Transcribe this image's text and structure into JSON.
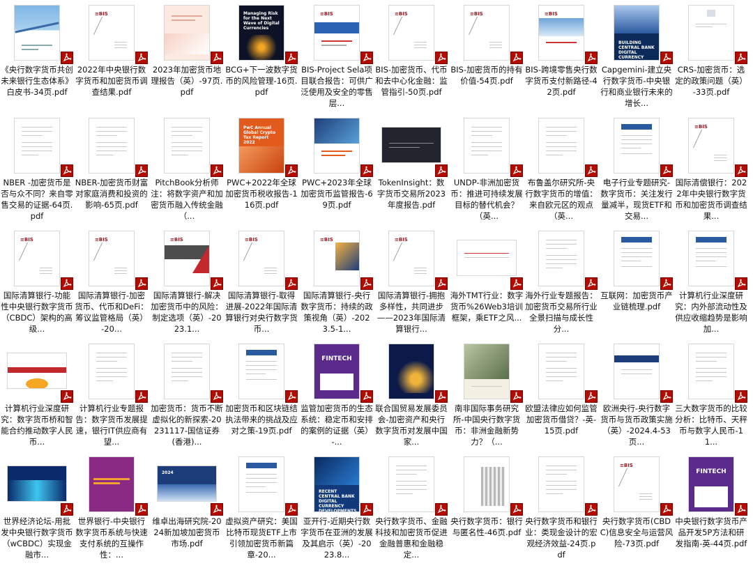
{
  "files": [
    {
      "label": "《央行数字货币共创未来银行生态体系》白皮书-34页.pdf",
      "thumb": "bridge"
    },
    {
      "label": "2022年中央银行数字货币和加密货币调查结果.pdf",
      "thumb": "bis"
    },
    {
      "label": "2023年加密货币地理报告（英）-97页.pdf",
      "thumb": "light"
    },
    {
      "label": "BCG+下一波数字货币的风险管理-16页.pdf",
      "thumb": "dark"
    },
    {
      "label": "BIS-Project Sela项目联合报告：可供广泛使用及安全的零售层...",
      "thumb": "bisblue"
    },
    {
      "label": "BIS-加密货币、代币和去中心化金融：监管指引-50页.pdf",
      "thumb": "bis"
    },
    {
      "label": "BIS-加密货币的持有价值-54页.pdf",
      "thumb": "bis"
    },
    {
      "label": "BIS-跨境零售央行数字货币支付新路径-42页.pdf",
      "thumb": "bisphoto"
    },
    {
      "label": "Capgemini-建立央行数字货币-中央银行和商业银行未来的增长...",
      "thumb": "capgemini"
    },
    {
      "label": "CRS-加密货币：选定的政策问题（英）-33页.pdf",
      "thumb": "crs"
    },
    {
      "label": "NBER -加密货币是否与众不同？来自零售交易的证据-64页.pdf",
      "thumb": "doc"
    },
    {
      "label": "NBER-加密货币财富对家庭消费和投资的影响-65页.pdf",
      "thumb": "doc"
    },
    {
      "label": "PitchBook分析师注：将数字资产和加密货币融入传统金融（...",
      "thumb": "doc"
    },
    {
      "label": "PWC+2022年全球加密货币税收报告-116页.pdf",
      "thumb": "orange"
    },
    {
      "label": "PWC+2023年全球加密货币监管报告-69页.pdf",
      "thumb": "pwc2"
    },
    {
      "label": "TokenInsight：数字货币交易所2023年度报告.pdf",
      "thumb": "token"
    },
    {
      "label": "UNDP-非洲加密货币：推进可持续发展目标的替代机会？（英...",
      "thumb": "doc"
    },
    {
      "label": "布鲁盖尔研究所-央行数字货币的增值：来自欧元区的观点（英...",
      "thumb": "doc"
    },
    {
      "label": "电子行业专题研究-数字货币：关注发行量减半，现货ETF和交易...",
      "thumb": "report"
    },
    {
      "label": "国际清偿银行：2022年中央银行数字货币和加密货币调查结果...",
      "thumb": "bis"
    },
    {
      "label": "国际清算银行-功能性中央银行数字货币（CBDC）架构的高级...",
      "thumb": "bis"
    },
    {
      "label": "国际清算银行-加密货币、代币和DeFi：筹议监管格局（英）-20...",
      "thumb": "bis"
    },
    {
      "label": "国际清算银行-解决加密货币中的风险：制定选项（英）-2023.1...",
      "thumb": "bulletin"
    },
    {
      "label": "国际清算银行-取得进展-2022年国际清算银行对央行数字货币...",
      "thumb": "bis"
    },
    {
      "label": "国际清算银行-央行数字货币：持续的政策视角（英）-2023.5-1...",
      "thumb": "bisgold"
    },
    {
      "label": "国际清算银行-拥抱多样性，共同进步——2023年国际清算银行...",
      "thumb": "bis"
    },
    {
      "label": "海外TMT行业：数字货币%26Web3培训框架，乘ETF之风...",
      "thumb": "slide"
    },
    {
      "label": "海外行业专题报告：加密货币交易所行业全景扫描与成长性分...",
      "thumb": "doc"
    },
    {
      "label": "互联网：加密货币产业链梳理.pdf",
      "thumb": "report"
    },
    {
      "label": "计算机行业深度研究：内外部流动性及供应收缩趋势是影响加...",
      "thumb": "report"
    },
    {
      "label": "计算机行业深度研究：数字货币桥和智能合约推动数字人民币...",
      "thumb": "redslide"
    },
    {
      "label": "计算机行业专题报告：数字货币发展提速，银行IT供应商有望...",
      "thumb": "doc"
    },
    {
      "label": "加密货币：货币不断虚拟化的新探索-20231117-国信证券(香港)...",
      "thumb": "doc"
    },
    {
      "label": "加密货币和区块链结执法带来的挑战及应对之策-19页.pdf",
      "thumb": "report"
    },
    {
      "label": "监管加密货币的生态系统：稳定币和安排的案例的证据（英）-...",
      "thumb": "fintech"
    },
    {
      "label": "联合国贸易发展委员会-加密资产和央行数字货币对发展中国家...",
      "thumb": "unctad"
    },
    {
      "label": "南非国际事务研究所-中国央行数字货币：非洲金融新势力？（...",
      "thumb": "money"
    },
    {
      "label": "欧盟法律应如何监管加密货币借贷？-英-15页.pdf",
      "thumb": "doc"
    },
    {
      "label": "欧洲央行-央行数字货币与货币政策实施（英）-2024.4-53页...",
      "thumb": "ecb"
    },
    {
      "label": "三大数字货币的比较分析：比特币、天秤币与数字人民币-11...",
      "thumb": "doc"
    },
    {
      "label": "世界经济论坛-用批发中央银行数字货币（wCBDC）实现金融市...",
      "thumb": "wef"
    },
    {
      "label": "世界银行-中央银行数字货币系统与快速支付系统的互操作性：...",
      "thumb": "wb"
    },
    {
      "label": "维卓出海研究院-2024新加坡加密货币市场.pdf",
      "thumb": "sg"
    },
    {
      "label": "虚拟资产研究：美国比特币现货ETF上市引领加密货币新篇章-20...",
      "thumb": "report"
    },
    {
      "label": "亚开行-近期央行数字货币在亚洲的发展及其启示（英）-2023.8...",
      "thumb": "adb"
    },
    {
      "label": "央行数字货币、金融科技和加密货币促进金融普惠和金融稳定...",
      "thumb": "doc"
    },
    {
      "label": "央行数字货币：银行与匿名性-46页.pdf",
      "thumb": "building"
    },
    {
      "label": "央行数字货币和银行业：类现金设计的宏观经济效益-24页.pdf",
      "thumb": "doc"
    },
    {
      "label": "央行数字货币(CBDC)信息安全与运营风险-73页.pdf",
      "thumb": "bis"
    },
    {
      "label": "中央银行数字货币产品开发5P方法和研发指南-英-44页.pdf",
      "thumb": "fintech2"
    }
  ]
}
